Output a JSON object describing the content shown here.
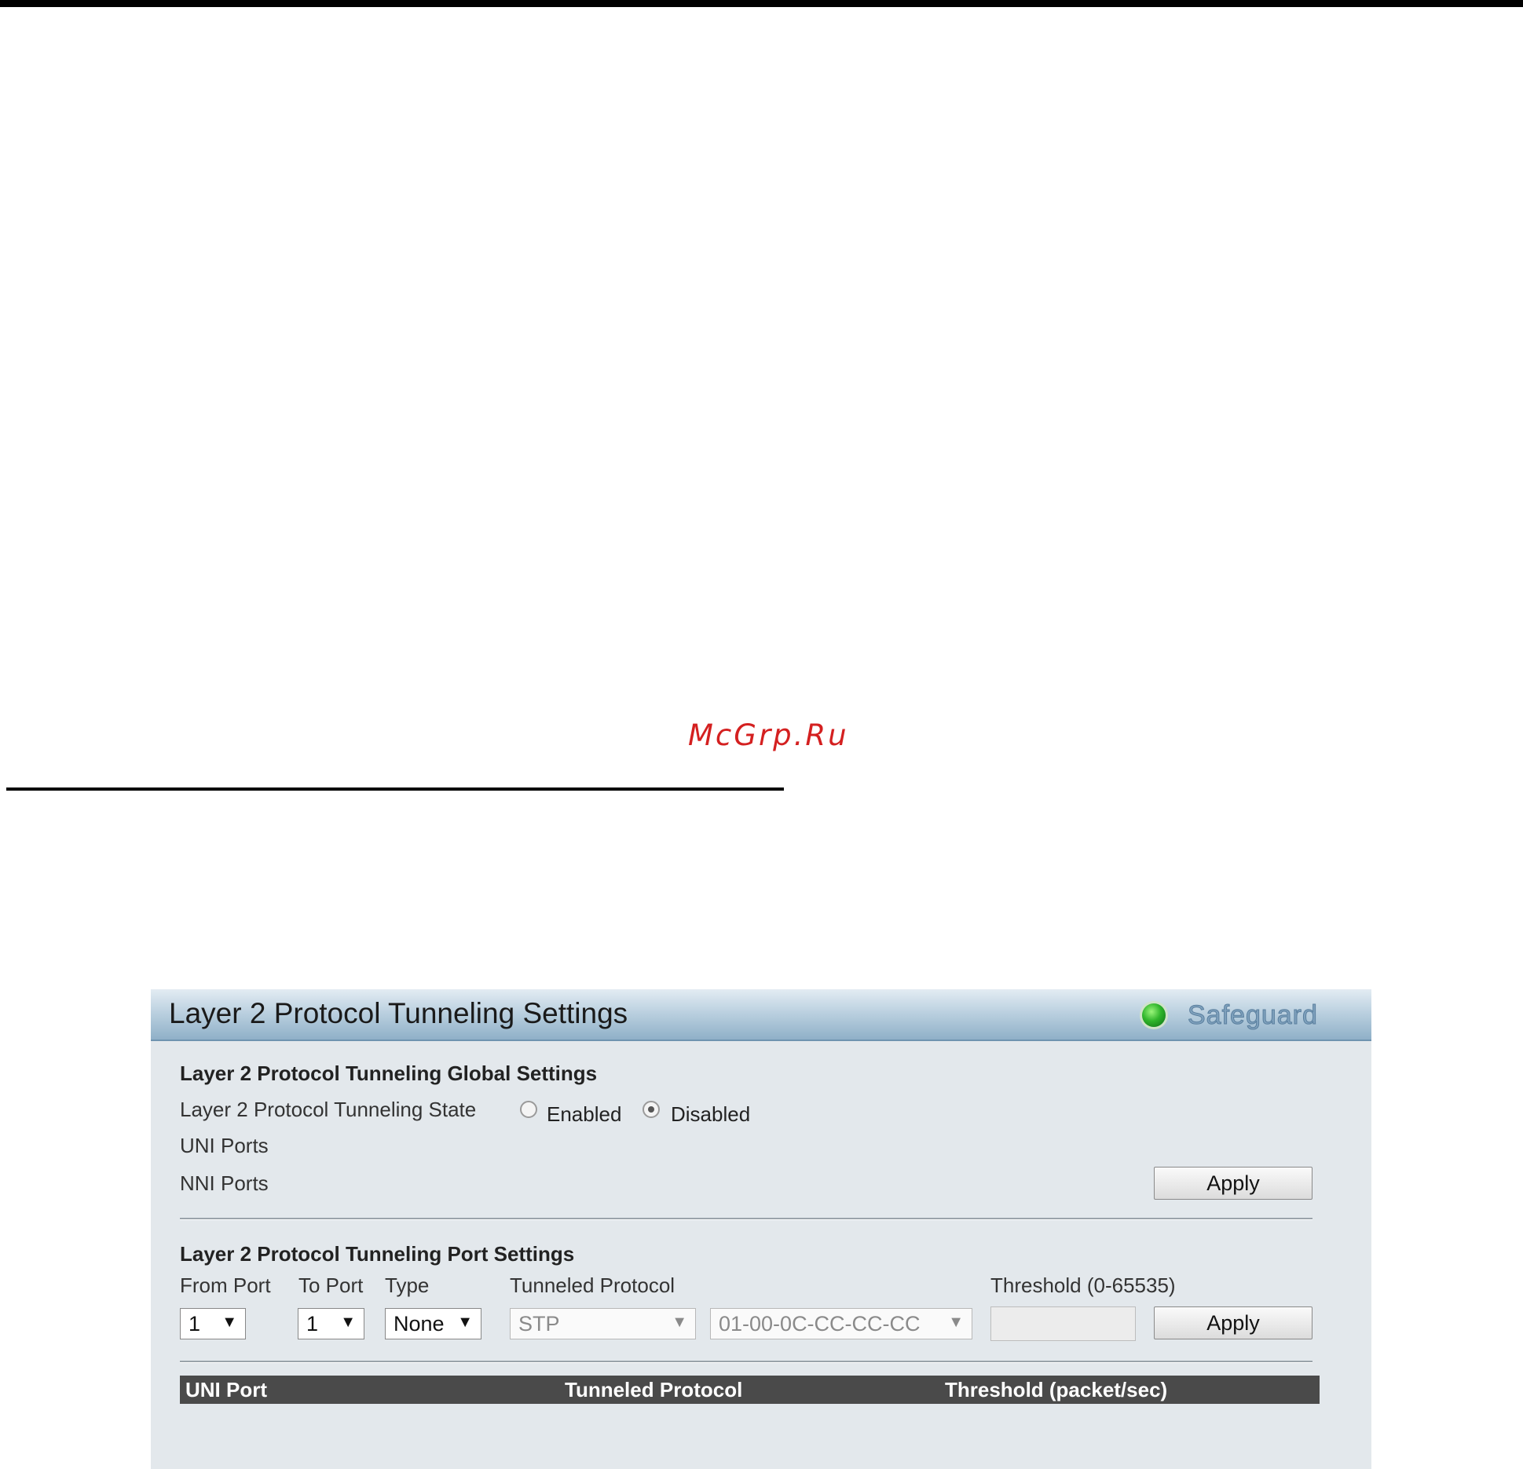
{
  "watermark": "McGrp.Ru",
  "panel": {
    "title": "Layer 2 Protocol Tunneling Settings",
    "safeguard_label": "Safeguard"
  },
  "global_settings": {
    "title": "Layer 2 Protocol Tunneling Global Settings",
    "state_label": "Layer 2 Protocol Tunneling State",
    "enabled_label": "Enabled",
    "disabled_label": "Disabled",
    "selected_state": "Disabled",
    "uni_ports_label": "UNI Ports",
    "nni_ports_label": "NNI Ports",
    "apply_label": "Apply"
  },
  "port_settings": {
    "title": "Layer 2 Protocol Tunneling Port Settings",
    "from_port_label": "From Port",
    "to_port_label": "To Port",
    "type_label": "Type",
    "tunneled_protocol_label": "Tunneled Protocol",
    "threshold_label": "Threshold (0-65535)",
    "from_port_value": "1",
    "to_port_value": "1",
    "type_value": "None",
    "protocol_value": "STP",
    "mac_value": "01-00-0C-CC-CC-CC",
    "threshold_value": "",
    "apply_label": "Apply"
  },
  "table": {
    "columns": [
      "UNI Port",
      "Tunneled Protocol",
      "Threshold (packet/sec)"
    ]
  }
}
